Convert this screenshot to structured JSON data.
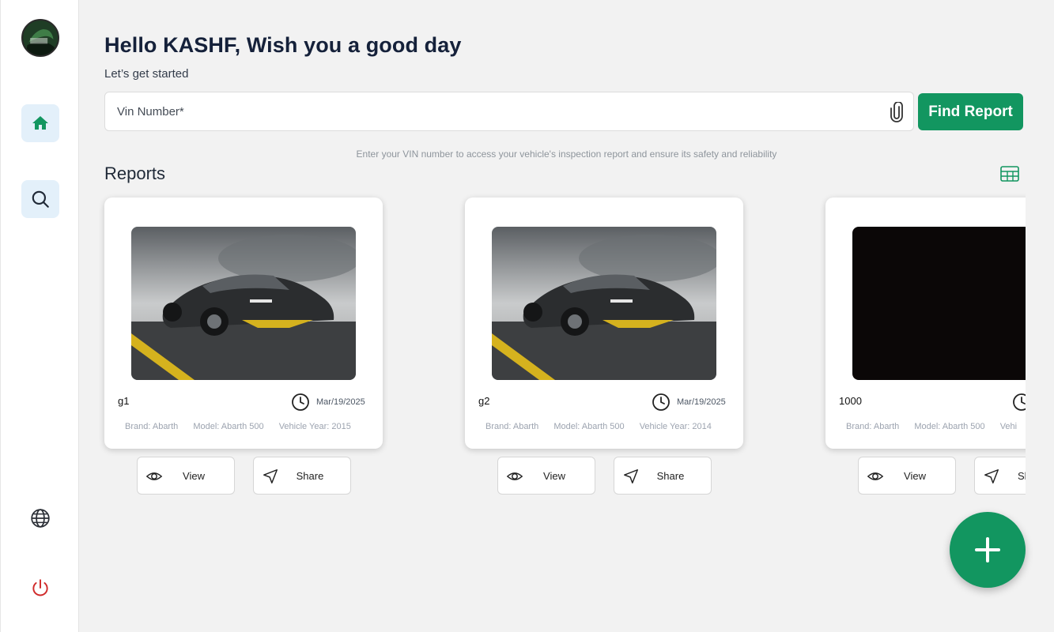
{
  "user": {
    "greeting": "Hello KASHF, Wish you a good day",
    "subtitle": "Let’s get started"
  },
  "sidebar": {
    "items": [
      {
        "name": "home",
        "icon": "home-icon",
        "active": true
      },
      {
        "name": "search",
        "icon": "search-icon"
      },
      {
        "name": "language",
        "icon": "globe-icon"
      },
      {
        "name": "logout",
        "icon": "power-icon"
      }
    ]
  },
  "search": {
    "placeholder": "Vin Number*",
    "value": "",
    "button_label": "Find Report",
    "helper": "Enter your VIN number to access your vehicle's inspection report and ensure its safety and reliability"
  },
  "reports": {
    "title": "Reports",
    "cards": [
      {
        "title": "g1",
        "date": "Mar/19/2025",
        "brand": "Brand: Abarth",
        "model": "Model: Abarth 500",
        "year": "Vehicle Year: 2015",
        "view_label": "View",
        "share_label": "Share",
        "image": "car"
      },
      {
        "title": "g2",
        "date": "Mar/19/2025",
        "brand": "Brand: Abarth",
        "model": "Model: Abarth 500",
        "year": "Vehicle Year: 2014",
        "view_label": "View",
        "share_label": "Share",
        "image": "car"
      },
      {
        "title": "1000",
        "date": "",
        "brand": "Brand: Abarth",
        "model": "Model: Abarth 500",
        "year": "Vehi",
        "view_label": "View",
        "share_label": "Sh",
        "image": "dark"
      }
    ]
  },
  "colors": {
    "accent": "#129660",
    "nav_bg": "#e3f0fa",
    "danger": "#d02b2b"
  }
}
